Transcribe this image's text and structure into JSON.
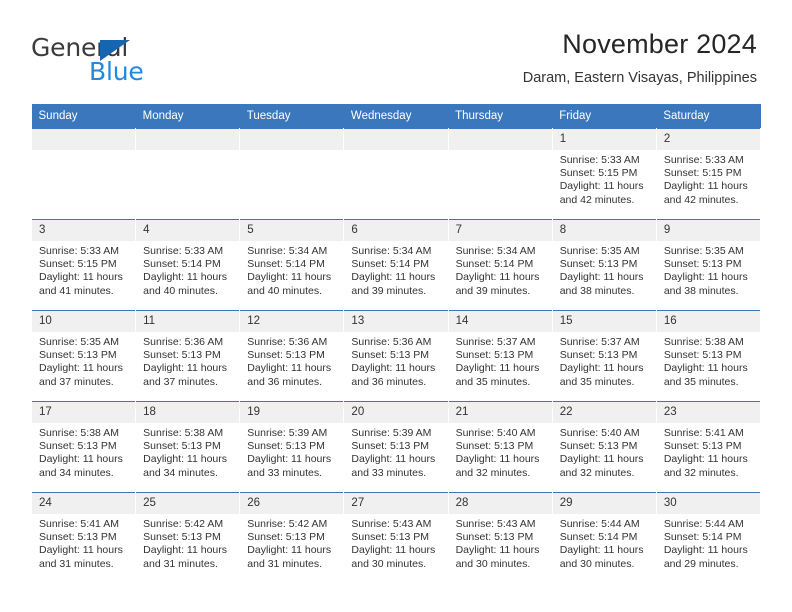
{
  "brand": {
    "name_top": "General",
    "name_bottom": "Blue",
    "triangle_color": "#1565b0",
    "blue_color": "#1f8ae0",
    "gray_color": "#3b3b3b"
  },
  "header": {
    "title": "November 2024",
    "subtitle": "Daram, Eastern Visayas, Philippines"
  },
  "theme": {
    "header_row_bg": "#3a77bd",
    "daynum_bg": "#f0f0f0",
    "grid_line": "#3a77bd",
    "text": "#333333"
  },
  "weekdays": [
    "Sunday",
    "Monday",
    "Tuesday",
    "Wednesday",
    "Thursday",
    "Friday",
    "Saturday"
  ],
  "labels": {
    "sunrise": "Sunrise:",
    "sunset": "Sunset:",
    "daylight": "Daylight:"
  },
  "weeks": [
    [
      {
        "day": "",
        "empty": true
      },
      {
        "day": "",
        "empty": true
      },
      {
        "day": "",
        "empty": true
      },
      {
        "day": "",
        "empty": true
      },
      {
        "day": "",
        "empty": true
      },
      {
        "day": "1",
        "sunrise": "Sunrise: 5:33 AM",
        "sunset": "Sunset: 5:15 PM",
        "daylight": "Daylight: 11 hours and 42 minutes."
      },
      {
        "day": "2",
        "sunrise": "Sunrise: 5:33 AM",
        "sunset": "Sunset: 5:15 PM",
        "daylight": "Daylight: 11 hours and 42 minutes."
      }
    ],
    [
      {
        "day": "3",
        "sunrise": "Sunrise: 5:33 AM",
        "sunset": "Sunset: 5:15 PM",
        "daylight": "Daylight: 11 hours and 41 minutes."
      },
      {
        "day": "4",
        "sunrise": "Sunrise: 5:33 AM",
        "sunset": "Sunset: 5:14 PM",
        "daylight": "Daylight: 11 hours and 40 minutes."
      },
      {
        "day": "5",
        "sunrise": "Sunrise: 5:34 AM",
        "sunset": "Sunset: 5:14 PM",
        "daylight": "Daylight: 11 hours and 40 minutes."
      },
      {
        "day": "6",
        "sunrise": "Sunrise: 5:34 AM",
        "sunset": "Sunset: 5:14 PM",
        "daylight": "Daylight: 11 hours and 39 minutes."
      },
      {
        "day": "7",
        "sunrise": "Sunrise: 5:34 AM",
        "sunset": "Sunset: 5:14 PM",
        "daylight": "Daylight: 11 hours and 39 minutes."
      },
      {
        "day": "8",
        "sunrise": "Sunrise: 5:35 AM",
        "sunset": "Sunset: 5:13 PM",
        "daylight": "Daylight: 11 hours and 38 minutes."
      },
      {
        "day": "9",
        "sunrise": "Sunrise: 5:35 AM",
        "sunset": "Sunset: 5:13 PM",
        "daylight": "Daylight: 11 hours and 38 minutes."
      }
    ],
    [
      {
        "day": "10",
        "sunrise": "Sunrise: 5:35 AM",
        "sunset": "Sunset: 5:13 PM",
        "daylight": "Daylight: 11 hours and 37 minutes."
      },
      {
        "day": "11",
        "sunrise": "Sunrise: 5:36 AM",
        "sunset": "Sunset: 5:13 PM",
        "daylight": "Daylight: 11 hours and 37 minutes."
      },
      {
        "day": "12",
        "sunrise": "Sunrise: 5:36 AM",
        "sunset": "Sunset: 5:13 PM",
        "daylight": "Daylight: 11 hours and 36 minutes."
      },
      {
        "day": "13",
        "sunrise": "Sunrise: 5:36 AM",
        "sunset": "Sunset: 5:13 PM",
        "daylight": "Daylight: 11 hours and 36 minutes."
      },
      {
        "day": "14",
        "sunrise": "Sunrise: 5:37 AM",
        "sunset": "Sunset: 5:13 PM",
        "daylight": "Daylight: 11 hours and 35 minutes."
      },
      {
        "day": "15",
        "sunrise": "Sunrise: 5:37 AM",
        "sunset": "Sunset: 5:13 PM",
        "daylight": "Daylight: 11 hours and 35 minutes."
      },
      {
        "day": "16",
        "sunrise": "Sunrise: 5:38 AM",
        "sunset": "Sunset: 5:13 PM",
        "daylight": "Daylight: 11 hours and 35 minutes."
      }
    ],
    [
      {
        "day": "17",
        "sunrise": "Sunrise: 5:38 AM",
        "sunset": "Sunset: 5:13 PM",
        "daylight": "Daylight: 11 hours and 34 minutes."
      },
      {
        "day": "18",
        "sunrise": "Sunrise: 5:38 AM",
        "sunset": "Sunset: 5:13 PM",
        "daylight": "Daylight: 11 hours and 34 minutes."
      },
      {
        "day": "19",
        "sunrise": "Sunrise: 5:39 AM",
        "sunset": "Sunset: 5:13 PM",
        "daylight": "Daylight: 11 hours and 33 minutes."
      },
      {
        "day": "20",
        "sunrise": "Sunrise: 5:39 AM",
        "sunset": "Sunset: 5:13 PM",
        "daylight": "Daylight: 11 hours and 33 minutes."
      },
      {
        "day": "21",
        "sunrise": "Sunrise: 5:40 AM",
        "sunset": "Sunset: 5:13 PM",
        "daylight": "Daylight: 11 hours and 32 minutes."
      },
      {
        "day": "22",
        "sunrise": "Sunrise: 5:40 AM",
        "sunset": "Sunset: 5:13 PM",
        "daylight": "Daylight: 11 hours and 32 minutes."
      },
      {
        "day": "23",
        "sunrise": "Sunrise: 5:41 AM",
        "sunset": "Sunset: 5:13 PM",
        "daylight": "Daylight: 11 hours and 32 minutes."
      }
    ],
    [
      {
        "day": "24",
        "sunrise": "Sunrise: 5:41 AM",
        "sunset": "Sunset: 5:13 PM",
        "daylight": "Daylight: 11 hours and 31 minutes."
      },
      {
        "day": "25",
        "sunrise": "Sunrise: 5:42 AM",
        "sunset": "Sunset: 5:13 PM",
        "daylight": "Daylight: 11 hours and 31 minutes."
      },
      {
        "day": "26",
        "sunrise": "Sunrise: 5:42 AM",
        "sunset": "Sunset: 5:13 PM",
        "daylight": "Daylight: 11 hours and 31 minutes."
      },
      {
        "day": "27",
        "sunrise": "Sunrise: 5:43 AM",
        "sunset": "Sunset: 5:13 PM",
        "daylight": "Daylight: 11 hours and 30 minutes."
      },
      {
        "day": "28",
        "sunrise": "Sunrise: 5:43 AM",
        "sunset": "Sunset: 5:13 PM",
        "daylight": "Daylight: 11 hours and 30 minutes."
      },
      {
        "day": "29",
        "sunrise": "Sunrise: 5:44 AM",
        "sunset": "Sunset: 5:14 PM",
        "daylight": "Daylight: 11 hours and 30 minutes."
      },
      {
        "day": "30",
        "sunrise": "Sunrise: 5:44 AM",
        "sunset": "Sunset: 5:14 PM",
        "daylight": "Daylight: 11 hours and 29 minutes."
      }
    ]
  ]
}
